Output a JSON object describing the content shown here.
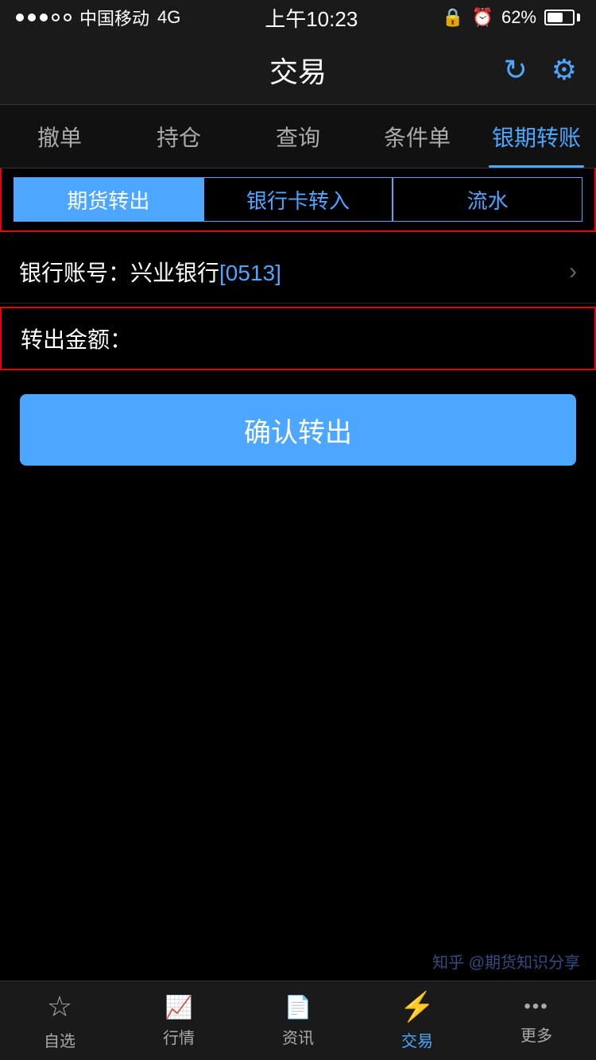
{
  "statusBar": {
    "carrier": "中国移动",
    "network": "4G",
    "time": "上午10:23",
    "battery": "62%"
  },
  "header": {
    "title": "交易",
    "refresh_label": "↻",
    "settings_label": "⚙"
  },
  "navTabs": [
    {
      "label": "撤单",
      "active": false
    },
    {
      "label": "持仓",
      "active": false
    },
    {
      "label": "查询",
      "active": false
    },
    {
      "label": "条件单",
      "active": false
    },
    {
      "label": "银期转账",
      "active": true
    }
  ],
  "subTabs": [
    {
      "label": "期货转出",
      "active": true
    },
    {
      "label": "银行卡转入",
      "active": false
    },
    {
      "label": "流水",
      "active": false
    }
  ],
  "bankAccount": {
    "prefix": "银行账号：兴业银行",
    "suffix": "[0513]"
  },
  "amountField": {
    "label": "转出金额：",
    "placeholder": ""
  },
  "confirmButton": {
    "label": "确认转出"
  },
  "bottomNav": [
    {
      "label": "自选",
      "icon": "☆",
      "active": false
    },
    {
      "label": "行情",
      "icon": "📈",
      "active": false
    },
    {
      "label": "资讯",
      "icon": "📄",
      "active": false
    },
    {
      "label": "交易",
      "icon": "⚡",
      "active": true
    },
    {
      "label": "更多",
      "icon": "•••",
      "active": false
    }
  ],
  "watermark": "知乎 @期货知识分享"
}
